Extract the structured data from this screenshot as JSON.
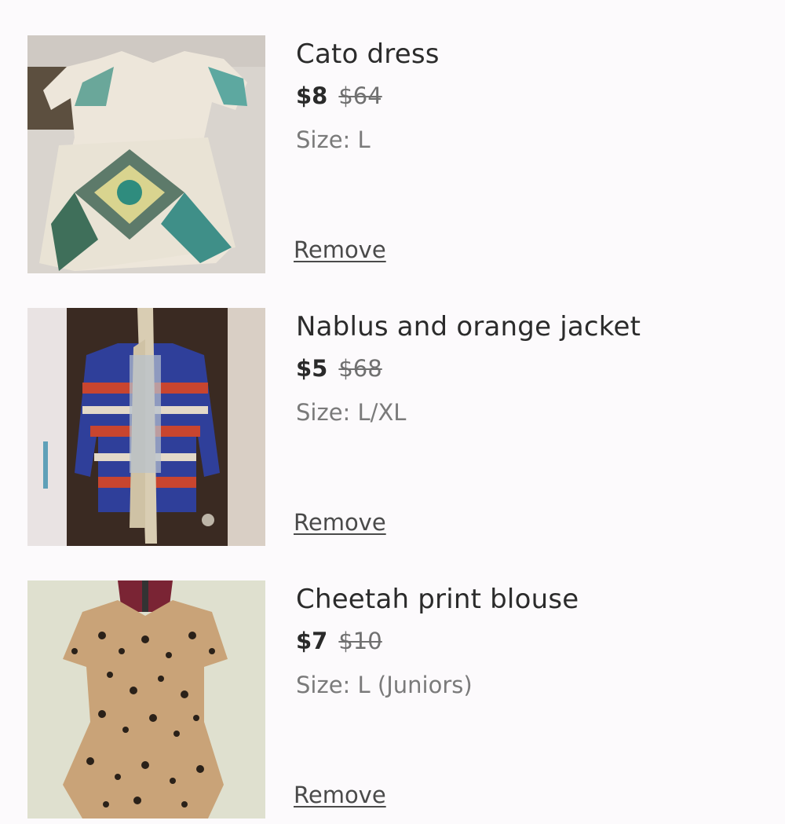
{
  "cart": {
    "items": [
      {
        "title": "Cato dress",
        "price": "$8",
        "original_price": "$64",
        "size": "Size: L",
        "remove_label": "Remove",
        "image_icon": "dress-photo"
      },
      {
        "title": "Nablus and orange jacket",
        "price": "$5",
        "original_price": "$68",
        "size": "Size: L/XL",
        "remove_label": "Remove",
        "image_icon": "jacket-photo"
      },
      {
        "title": "Cheetah print blouse",
        "price": "$7",
        "original_price": "$10",
        "size": "Size: L (Juniors)",
        "remove_label": "Remove",
        "image_icon": "blouse-photo"
      }
    ]
  },
  "colors": {
    "background": "#fcfafc",
    "text": "#2b2b2b",
    "muted": "#7a7a7a"
  }
}
